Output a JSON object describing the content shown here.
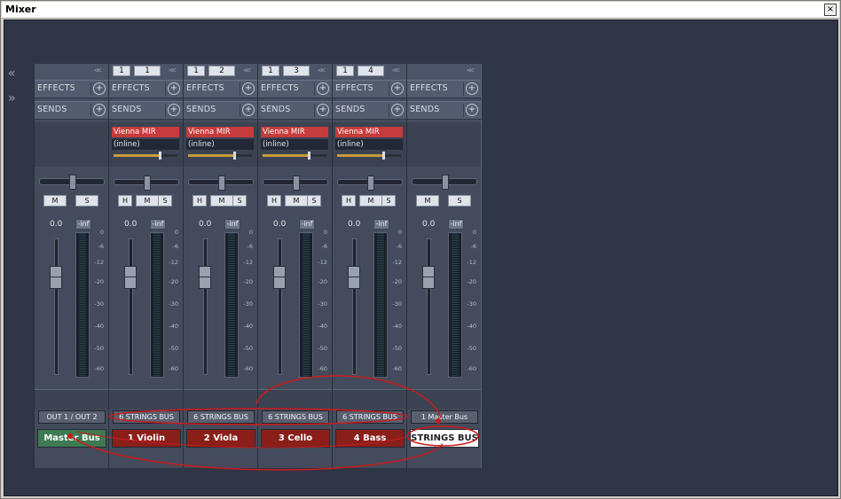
{
  "window": {
    "title": "Mixer",
    "close_label": "×"
  },
  "nav": {
    "left": "«",
    "right": "»"
  },
  "collapse_glyph": "<<",
  "labels": {
    "effects": "EFFECTS",
    "sends": "SENDS",
    "plus": "+",
    "H": "H",
    "M": "M",
    "S": "S",
    "gain": "0.0",
    "peak": "-inf"
  },
  "meter_scale": [
    "0",
    "-6",
    "-12",
    "-20",
    "-30",
    "-40",
    "-50",
    "-60"
  ],
  "strips": [
    {
      "name": "Master Bus",
      "color": "#3e7a52",
      "route": "OUT 1 / OUT 2",
      "channel": null,
      "plugin": null,
      "inline": null,
      "buttons": [
        "M",
        "S"
      ]
    },
    {
      "name": "1 Violin",
      "color": "#8a1f1a",
      "route": "6 STRINGS BUS",
      "channel": [
        "1",
        "1"
      ],
      "plugin": "Vienna MIR",
      "inline": "(inline)",
      "buttons": [
        "H",
        "M",
        "S"
      ]
    },
    {
      "name": "2 Viola",
      "color": "#8a1f1a",
      "route": "6 STRINGS BUS",
      "channel": [
        "1",
        "2"
      ],
      "plugin": "Vienna MIR",
      "inline": "(inline)",
      "buttons": [
        "H",
        "M",
        "S"
      ]
    },
    {
      "name": "3 Cello",
      "color": "#8a1f1a",
      "route": "6 STRINGS BUS",
      "channel": [
        "1",
        "3"
      ],
      "plugin": "Vienna MIR",
      "inline": "(inline)",
      "buttons": [
        "H",
        "M",
        "S"
      ]
    },
    {
      "name": "4 Bass",
      "color": "#8a1f1a",
      "route": "6 STRINGS BUS",
      "channel": [
        "1",
        "4"
      ],
      "plugin": "Vienna MIR",
      "inline": "(inline)",
      "buttons": [
        "H",
        "M",
        "S"
      ]
    },
    {
      "name": "STRINGS BUS",
      "color": "#ffffff",
      "route": "1 Master Bus",
      "channel": null,
      "plugin": null,
      "inline": null,
      "buttons": [
        "M",
        "S"
      ]
    }
  ],
  "annotation_color": "#cc1a1a"
}
